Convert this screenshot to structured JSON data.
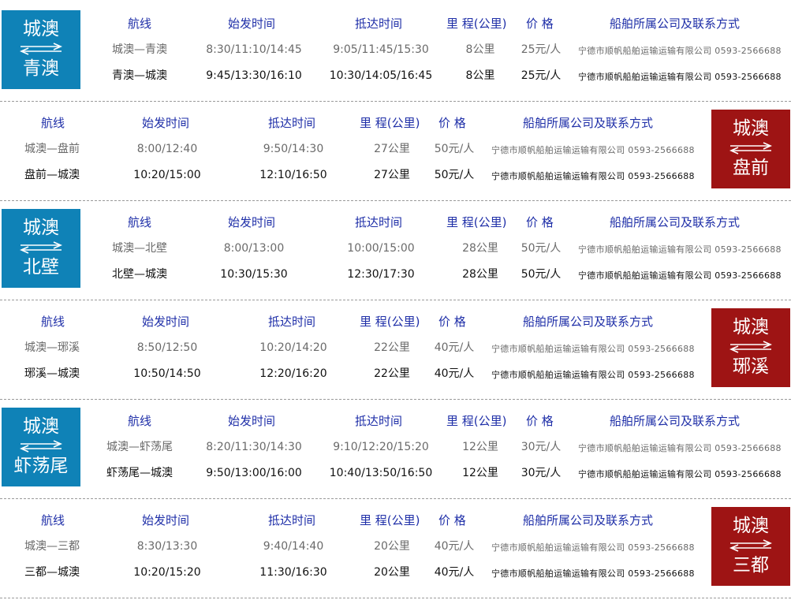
{
  "headers": {
    "route": "航线",
    "depart": "始发时间",
    "arrive": "抵达时间",
    "distance": "里 程(公里)",
    "price": "价 格",
    "company": "船舶所属公司及联系方式"
  },
  "colors": {
    "header_text": "#1f2fa8",
    "badge_blue": "#0f82b7",
    "badge_red": "#9e1414"
  },
  "routes": [
    {
      "badge": {
        "origin": "城澳",
        "dest": "青澳",
        "color": "blue"
      },
      "rows": [
        {
          "route": "城澳—青澳",
          "depart": "8:30/11:10/14:45",
          "arrive": "9:05/11:45/15:30",
          "distance": "8公里",
          "price": "25元/人",
          "company": "宁德市顺帆船舶运输运输有限公司  0593-2566688"
        },
        {
          "route": "青澳—城澳",
          "depart": "9:45/13:30/16:10",
          "arrive": "10:30/14:05/16:45",
          "distance": "8公里",
          "price": "25元/人",
          "company": "宁德市顺帆船舶运输运输有限公司  0593-2566688"
        }
      ]
    },
    {
      "badge": {
        "origin": "城澳",
        "dest": "盘前",
        "color": "red"
      },
      "rows": [
        {
          "route": "城澳—盘前",
          "depart": "8:00/12:40",
          "arrive": "9:50/14:30",
          "distance": "27公里",
          "price": "50元/人",
          "company": "宁德市顺帆船舶运输运输有限公司  0593-2566688"
        },
        {
          "route": "盘前—城澳",
          "depart": "10:20/15:00",
          "arrive": "12:10/16:50",
          "distance": "27公里",
          "price": "50元/人",
          "company": "宁德市顺帆船舶运输运输有限公司  0593-2566688"
        }
      ]
    },
    {
      "badge": {
        "origin": "城澳",
        "dest": "北壁",
        "color": "blue"
      },
      "rows": [
        {
          "route": "城澳—北壁",
          "depart": "8:00/13:00",
          "arrive": "10:00/15:00",
          "distance": "28公里",
          "price": "50元/人",
          "company": "宁德市顺帆船舶运输运输有限公司  0593-2566688"
        },
        {
          "route": "北壁—城澳",
          "depart": "10:30/15:30",
          "arrive": "12:30/17:30",
          "distance": "28公里",
          "price": "50元/人",
          "company": "宁德市顺帆船舶运输运输有限公司  0593-2566688"
        }
      ]
    },
    {
      "badge": {
        "origin": "城澳",
        "dest": "琊溪",
        "color": "red"
      },
      "rows": [
        {
          "route": "城澳—琊溪",
          "depart": "8:50/12:50",
          "arrive": "10:20/14:20",
          "distance": "22公里",
          "price": "40元/人",
          "company": "宁德市顺帆船舶运输运输有限公司  0593-2566688"
        },
        {
          "route": "琊溪—城澳",
          "depart": "10:50/14:50",
          "arrive": "12:20/16:20",
          "distance": "22公里",
          "price": "40元/人",
          "company": "宁德市顺帆船舶运输运输有限公司  0593-2566688"
        }
      ]
    },
    {
      "badge": {
        "origin": "城澳",
        "dest": "虾荡尾",
        "color": "blue"
      },
      "rows": [
        {
          "route": "城澳—虾荡尾",
          "depart": "8:20/11:30/14:30",
          "arrive": "9:10/12:20/15:20",
          "distance": "12公里",
          "price": "30元/人",
          "company": "宁德市顺帆船舶运输运输有限公司  0593-2566688"
        },
        {
          "route": "虾荡尾—城澳",
          "depart": "9:50/13:00/16:00",
          "arrive": "10:40/13:50/16:50",
          "distance": "12公里",
          "price": "30元/人",
          "company": "宁德市顺帆船舶运输运输有限公司  0593-2566688"
        }
      ]
    },
    {
      "badge": {
        "origin": "城澳",
        "dest": "三都",
        "color": "red"
      },
      "rows": [
        {
          "route": "城澳—三都",
          "depart": "8:30/13:30",
          "arrive": "9:40/14:40",
          "distance": "20公里",
          "price": "40元/人",
          "company": "宁德市顺帆船舶运输运输有限公司  0593-2566688"
        },
        {
          "route": "三都—城澳",
          "depart": "10:20/15:20",
          "arrive": "11:30/16:30",
          "distance": "20公里",
          "price": "40元/人",
          "company": "宁德市顺帆船舶运输运输有限公司  0593-2566688"
        }
      ]
    }
  ]
}
